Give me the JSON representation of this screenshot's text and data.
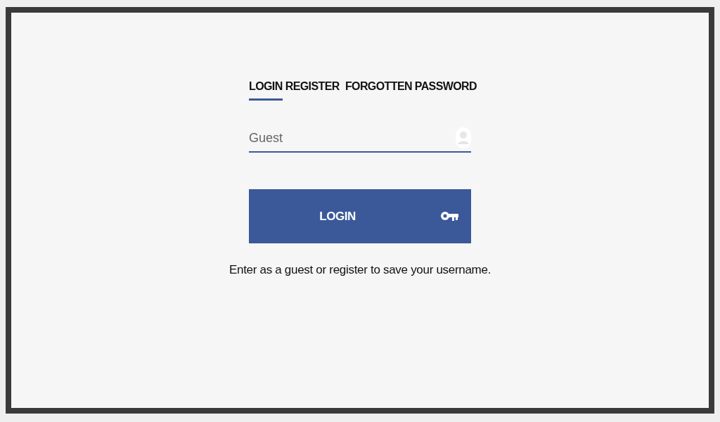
{
  "tabs": [
    {
      "label": "LOGIN",
      "selected": true
    },
    {
      "label": "REGISTER",
      "selected": false
    },
    {
      "label": "FORGOTTEN PASSWORD",
      "selected": false
    }
  ],
  "username_field": {
    "placeholder": "Guest"
  },
  "login_button": {
    "label": "LOGIN"
  },
  "hint": "Enter as a guest or register to save your username."
}
